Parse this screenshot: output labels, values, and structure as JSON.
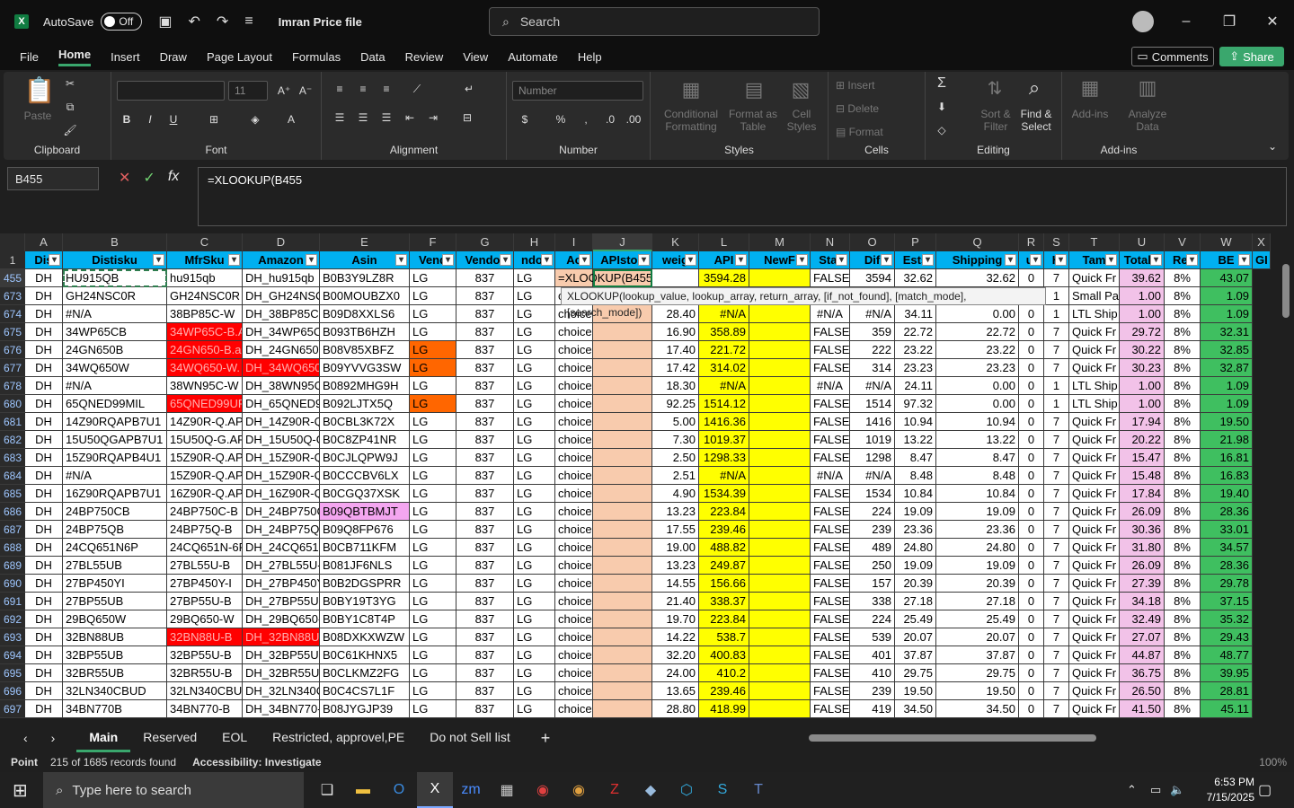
{
  "titlebar": {
    "autosave_label": "AutoSave",
    "autosave_state": "Off",
    "filename": "Imran Price file",
    "search_placeholder": "Search"
  },
  "menu": [
    "File",
    "Home",
    "Insert",
    "Draw",
    "Page Layout",
    "Formulas",
    "Data",
    "Review",
    "View",
    "Automate",
    "Help"
  ],
  "menu_active": "Home",
  "actions": {
    "comments": "Comments",
    "share": "Share"
  },
  "ribbon": {
    "clipboard": {
      "label": "Clipboard",
      "paste": "Paste"
    },
    "font": {
      "label": "Font",
      "size": "11"
    },
    "alignment": {
      "label": "Alignment"
    },
    "number": {
      "label": "Number",
      "format": "Number"
    },
    "styles": {
      "label": "Styles",
      "conditional": "Conditional Formatting",
      "format_table": "Format as Table",
      "cell_styles": "Cell Styles"
    },
    "cells": {
      "label": "Cells",
      "insert": "Insert",
      "delete": "Delete",
      "format": "Format"
    },
    "editing": {
      "label": "Editing",
      "sort": "Sort & Filter",
      "find": "Find & Select"
    },
    "addins": {
      "label": "Add-ins",
      "addins": "Add-ins",
      "analyze": "Analyze Data"
    }
  },
  "formula_bar": {
    "name_box": "B455",
    "formula": "=XLOOKUP(B455"
  },
  "tooltip": "XLOOKUP(lookup_value, lookup_array, return_array, [if_not_found], [match_mode], [search_mode])",
  "columns": [
    {
      "letter": "A",
      "header": "Dis"
    },
    {
      "letter": "B",
      "header": "Distisku"
    },
    {
      "letter": "C",
      "header": "MfrSku"
    },
    {
      "letter": "D",
      "header": "Amazon"
    },
    {
      "letter": "E",
      "header": "Asin"
    },
    {
      "letter": "F",
      "header": "Vend"
    },
    {
      "letter": "G",
      "header": "Vendor"
    },
    {
      "letter": "H",
      "header": "ndor"
    },
    {
      "letter": "I",
      "header": "Ac"
    },
    {
      "letter": "J",
      "header": "APIstoc"
    },
    {
      "letter": "K",
      "header": "weig"
    },
    {
      "letter": "L",
      "header": "API"
    },
    {
      "letter": "M",
      "header": "NewF"
    },
    {
      "letter": "N",
      "header": "Stat"
    },
    {
      "letter": "O",
      "header": "Dif"
    },
    {
      "letter": "P",
      "header": "Ests"
    },
    {
      "letter": "Q",
      "header": "Shipping"
    },
    {
      "letter": "R",
      "header": "ui"
    },
    {
      "letter": "S",
      "header": "H"
    },
    {
      "letter": "T",
      "header": "Tam"
    },
    {
      "letter": "U",
      "header": "TotalC"
    },
    {
      "letter": "V",
      "header": "Ret"
    },
    {
      "letter": "W",
      "header": "BE"
    },
    {
      "letter": "X",
      "header": "GI"
    }
  ],
  "rows": [
    {
      "n": "455",
      "c": [
        "DH",
        "HU915QB",
        "hu915qb",
        "DH_hu915qb",
        "B0B3Y9LZ8R",
        "LG",
        "837",
        "LG",
        "=XLOOKUP(B455",
        "",
        "",
        "3594.28",
        "",
        "FALSE",
        "3594",
        "32.62",
        "32.62",
        "0",
        "7",
        "Quick Fr",
        "39.62",
        "8%",
        "43.07"
      ]
    },
    {
      "n": "673",
      "c": [
        "DH",
        "GH24NSC0R",
        "GH24NSC0R",
        "DH_GH24NSC",
        "B00MOUBZX0",
        "LG",
        "837",
        "LG",
        "c",
        "",
        "",
        "",
        "",
        "",
        "",
        "",
        "",
        "",
        "1",
        "Small Pa",
        "1.00",
        "8%",
        "1.09"
      ]
    },
    {
      "n": "674",
      "c": [
        "DH",
        "#N/A",
        "38BP85C-W",
        "DH_38BP85C-",
        "B09D8XXLS6",
        "LG",
        "837",
        "LG",
        "choice",
        "",
        "28.40",
        "#N/A",
        "",
        "#N/A",
        "#N/A",
        "34.11",
        "0.00",
        "0",
        "1",
        "LTL Ship",
        "1.00",
        "8%",
        "1.09"
      ]
    },
    {
      "n": "675",
      "c": [
        "DH",
        "34WP65CB",
        "34WP65C-B.A",
        "DH_34WP65C",
        "B093TB6HZH",
        "LG",
        "837",
        "LG",
        "choice",
        "",
        "16.90",
        "358.89",
        "",
        "FALSE",
        "359",
        "22.72",
        "22.72",
        "0",
        "7",
        "Quick Fr",
        "29.72",
        "8%",
        "32.31"
      ]
    },
    {
      "n": "676",
      "c": [
        "DH",
        "24GN650B",
        "24GN650-B.a",
        "DH_24GN650-",
        "B08V85XBFZ",
        "LG",
        "837",
        "LG",
        "choice",
        "",
        "17.40",
        "221.72",
        "",
        "FALSE",
        "222",
        "23.22",
        "23.22",
        "0",
        "7",
        "Quick Fr",
        "30.22",
        "8%",
        "32.85"
      ]
    },
    {
      "n": "677",
      "c": [
        "DH",
        "34WQ650W",
        "34WQ650-W.",
        "DH_34WQ650",
        "B09YVVG3SW",
        "LG",
        "837",
        "LG",
        "choice",
        "",
        "17.42",
        "314.02",
        "",
        "FALSE",
        "314",
        "23.23",
        "23.23",
        "0",
        "7",
        "Quick Fr",
        "30.23",
        "8%",
        "32.87"
      ]
    },
    {
      "n": "678",
      "c": [
        "DH",
        "#N/A",
        "38WN95C-W",
        "DH_38WN95C",
        "B0892MHG9H",
        "LG",
        "837",
        "LG",
        "choice",
        "",
        "18.30",
        "#N/A",
        "",
        "#N/A",
        "#N/A",
        "24.11",
        "0.00",
        "0",
        "1",
        "LTL Ship",
        "1.00",
        "8%",
        "1.09"
      ]
    },
    {
      "n": "680",
      "c": [
        "DH",
        "65QNED99MIL",
        "65QNED99UP",
        "DH_65QNED9",
        "B092LJTX5Q",
        "LG",
        "837",
        "LG",
        "choice",
        "",
        "92.25",
        "1514.12",
        "",
        "FALSE",
        "1514",
        "97.32",
        "0.00",
        "0",
        "1",
        "LTL Ship",
        "1.00",
        "8%",
        "1.09"
      ]
    },
    {
      "n": "681",
      "c": [
        "DH",
        "14Z90RQAPB7U1",
        "14Z90R-Q.AP",
        "DH_14Z90R-Q",
        "B0CBL3K72X",
        "LG",
        "837",
        "LG",
        "choice",
        "",
        "5.00",
        "1416.36",
        "",
        "FALSE",
        "1416",
        "10.94",
        "10.94",
        "0",
        "7",
        "Quick Fr",
        "17.94",
        "8%",
        "19.50"
      ]
    },
    {
      "n": "682",
      "c": [
        "DH",
        "15U50QGAPB7U1",
        "15U50Q-G.AP",
        "DH_15U50Q-G",
        "B0C8ZP41NR",
        "LG",
        "837",
        "LG",
        "choice",
        "",
        "7.30",
        "1019.37",
        "",
        "FALSE",
        "1019",
        "13.22",
        "13.22",
        "0",
        "7",
        "Quick Fr",
        "20.22",
        "8%",
        "21.98"
      ]
    },
    {
      "n": "683",
      "c": [
        "DH",
        "15Z90RQAPB4U1",
        "15Z90R-Q.AP",
        "DH_15Z90R-Q",
        "B0CJLQPW9J",
        "LG",
        "837",
        "LG",
        "choice",
        "",
        "2.50",
        "1298.33",
        "",
        "FALSE",
        "1298",
        "8.47",
        "8.47",
        "0",
        "7",
        "Quick Fr",
        "15.47",
        "8%",
        "16.81"
      ]
    },
    {
      "n": "684",
      "c": [
        "DH",
        "#N/A",
        "15Z90R-Q.AP",
        "DH_15Z90R-Q",
        "B0CCCBV6LX",
        "LG",
        "837",
        "LG",
        "choice",
        "",
        "2.51",
        "#N/A",
        "",
        "#N/A",
        "#N/A",
        "8.48",
        "8.48",
        "0",
        "7",
        "Quick Fr",
        "15.48",
        "8%",
        "16.83"
      ]
    },
    {
      "n": "685",
      "c": [
        "DH",
        "16Z90RQAPB7U1",
        "16Z90R-Q.AP",
        "DH_16Z90R-Q",
        "B0CGQ37XSK",
        "LG",
        "837",
        "LG",
        "choice",
        "",
        "4.90",
        "1534.39",
        "",
        "FALSE",
        "1534",
        "10.84",
        "10.84",
        "0",
        "7",
        "Quick Fr",
        "17.84",
        "8%",
        "19.40"
      ]
    },
    {
      "n": "686",
      "c": [
        "DH",
        "24BP750CB",
        "24BP750C-B",
        "DH_24BP750C",
        "B09QBTBMJT",
        "LG",
        "837",
        "LG",
        "choice",
        "",
        "13.23",
        "223.84",
        "",
        "FALSE",
        "224",
        "19.09",
        "19.09",
        "0",
        "7",
        "Quick Fr",
        "26.09",
        "8%",
        "28.36"
      ]
    },
    {
      "n": "687",
      "c": [
        "DH",
        "24BP75QB",
        "24BP75Q-B",
        "DH_24BP75Q-",
        "B09Q8FP676",
        "LG",
        "837",
        "LG",
        "choice",
        "",
        "17.55",
        "239.46",
        "",
        "FALSE",
        "239",
        "23.36",
        "23.36",
        "0",
        "7",
        "Quick Fr",
        "30.36",
        "8%",
        "33.01"
      ]
    },
    {
      "n": "688",
      "c": [
        "DH",
        "24CQ651N6P",
        "24CQ651N-6P",
        "DH_24CQ651N",
        "B0CB711KFM",
        "LG",
        "837",
        "LG",
        "choice",
        "",
        "19.00",
        "488.82",
        "",
        "FALSE",
        "489",
        "24.80",
        "24.80",
        "0",
        "7",
        "Quick Fr",
        "31.80",
        "8%",
        "34.57"
      ]
    },
    {
      "n": "689",
      "c": [
        "DH",
        "27BL55UB",
        "27BL55U-B",
        "DH_27BL55U-",
        "B081JF6NLS",
        "LG",
        "837",
        "LG",
        "choice",
        "",
        "13.23",
        "249.87",
        "",
        "FALSE",
        "250",
        "19.09",
        "19.09",
        "0",
        "7",
        "Quick Fr",
        "26.09",
        "8%",
        "28.36"
      ]
    },
    {
      "n": "690",
      "c": [
        "DH",
        "27BP450YI",
        "27BP450Y-I",
        "DH_27BP450Y",
        "B0B2DGSPRR",
        "LG",
        "837",
        "LG",
        "choice",
        "",
        "14.55",
        "156.66",
        "",
        "FALSE",
        "157",
        "20.39",
        "20.39",
        "0",
        "7",
        "Quick Fr",
        "27.39",
        "8%",
        "29.78"
      ]
    },
    {
      "n": "691",
      "c": [
        "DH",
        "27BP55UB",
        "27BP55U-B",
        "DH_27BP55U-",
        "B0BY19T3YG",
        "LG",
        "837",
        "LG",
        "choice",
        "",
        "21.40",
        "338.37",
        "",
        "FALSE",
        "338",
        "27.18",
        "27.18",
        "0",
        "7",
        "Quick Fr",
        "34.18",
        "8%",
        "37.15"
      ]
    },
    {
      "n": "692",
      "c": [
        "DH",
        "29BQ650W",
        "29BQ650-W",
        "DH_29BQ650-",
        "B0BY1C8T4P",
        "LG",
        "837",
        "LG",
        "choice",
        "",
        "19.70",
        "223.84",
        "",
        "FALSE",
        "224",
        "25.49",
        "25.49",
        "0",
        "7",
        "Quick Fr",
        "32.49",
        "8%",
        "35.32"
      ]
    },
    {
      "n": "693",
      "c": [
        "DH",
        "32BN88UB",
        "32BN88U-B",
        "DH_32BN88U-",
        "B08DXKXWZW",
        "LG",
        "837",
        "LG",
        "choice",
        "",
        "14.22",
        "538.7",
        "",
        "FALSE",
        "539",
        "20.07",
        "20.07",
        "0",
        "7",
        "Quick Fr",
        "27.07",
        "8%",
        "29.43"
      ]
    },
    {
      "n": "694",
      "c": [
        "DH",
        "32BP55UB",
        "32BP55U-B",
        "DH_32BP55U-",
        "B0C61KHNX5",
        "LG",
        "837",
        "LG",
        "choice",
        "",
        "32.20",
        "400.83",
        "",
        "FALSE",
        "401",
        "37.87",
        "37.87",
        "0",
        "7",
        "Quick Fr",
        "44.87",
        "8%",
        "48.77"
      ]
    },
    {
      "n": "695",
      "c": [
        "DH",
        "32BR55UB",
        "32BR55U-B",
        "DH_32BR55U-",
        "B0CLKMZ2FG",
        "LG",
        "837",
        "LG",
        "choice",
        "",
        "24.00",
        "410.2",
        "",
        "FALSE",
        "410",
        "29.75",
        "29.75",
        "0",
        "7",
        "Quick Fr",
        "36.75",
        "8%",
        "39.95"
      ]
    },
    {
      "n": "696",
      "c": [
        "DH",
        "32LN340CBUD",
        "32LN340CBUI",
        "DH_32LN340C",
        "B0C4CS7L1F",
        "LG",
        "837",
        "LG",
        "choice",
        "",
        "13.65",
        "239.46",
        "",
        "FALSE",
        "239",
        "19.50",
        "19.50",
        "0",
        "7",
        "Quick Fr",
        "26.50",
        "8%",
        "28.81"
      ]
    },
    {
      "n": "697",
      "c": [
        "DH",
        "34BN770B",
        "34BN770-B",
        "DH_34BN770-",
        "B08JYGJP39",
        "LG",
        "837",
        "LG",
        "choice",
        "",
        "28.80",
        "418.99",
        "",
        "FALSE",
        "419",
        "34.50",
        "34.50",
        "0",
        "7",
        "Quick Fr",
        "41.50",
        "8%",
        "45.11"
      ]
    }
  ],
  "sheet_tabs": [
    "Main",
    "Reserved",
    "EOL",
    "Restricted, approvel,PE",
    "Do not Sell list"
  ],
  "sheet_active": "Main",
  "status": {
    "mode": "Point",
    "records": "215 of 1685 records found",
    "accessibility": "Accessibility: Investigate",
    "zoom": "100%"
  },
  "taskbar": {
    "search_placeholder": "Type here to search",
    "time": "6:53 PM",
    "date": "7/15/2025"
  },
  "colors": {
    "header_blue": "#00b0f0",
    "red": "#ff0000",
    "orange": "#ff6600",
    "pink": "#f4a6f0",
    "salmon": "#f8cbad",
    "yellow": "#ffff00",
    "light_pink": "#f2c2e8",
    "green": "#3fbf60",
    "excel_green": "#107c41"
  }
}
